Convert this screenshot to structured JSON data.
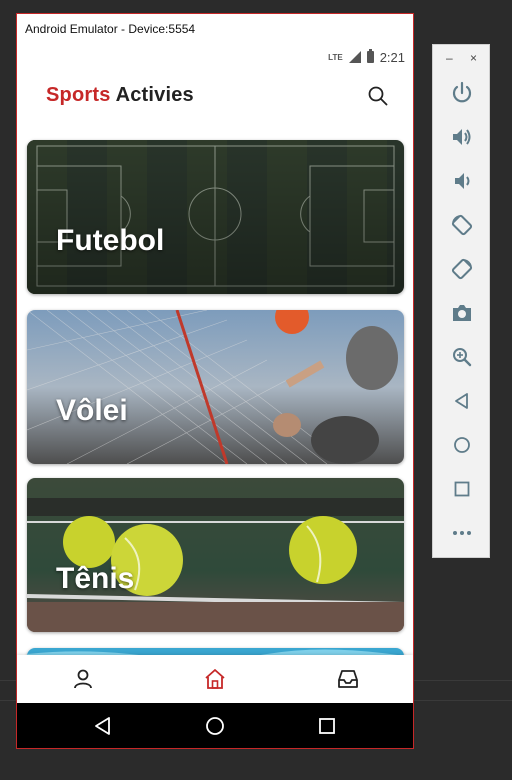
{
  "emulator": {
    "title": "Android Emulator - Device:5554"
  },
  "status_bar": {
    "network": "LTE",
    "time": "2:21"
  },
  "app": {
    "title_part1": "Sports",
    "title_part2": "Activies",
    "brand_color": "#c62828"
  },
  "cards": [
    {
      "label": "Futebol",
      "image": "soccer-field"
    },
    {
      "label": "Vôlei",
      "image": "volleyball-net"
    },
    {
      "label": "Tênis",
      "image": "tennis-balls"
    },
    {
      "label": "",
      "image": "water"
    }
  ],
  "bottom_nav": {
    "items": [
      "profile-icon",
      "home-icon",
      "inbox-icon"
    ],
    "active": "home-icon"
  },
  "android_nav": [
    "back-icon",
    "home-circle-icon",
    "recents-icon"
  ],
  "side_toolbar": {
    "window_controls": [
      "minimize-icon",
      "close-icon"
    ],
    "buttons": [
      "power-icon",
      "volume-up-icon",
      "volume-down-icon",
      "rotate-left-icon",
      "rotate-right-icon",
      "camera-icon",
      "zoom-icon",
      "back-icon",
      "home-icon",
      "overview-icon",
      "more-icon"
    ]
  }
}
